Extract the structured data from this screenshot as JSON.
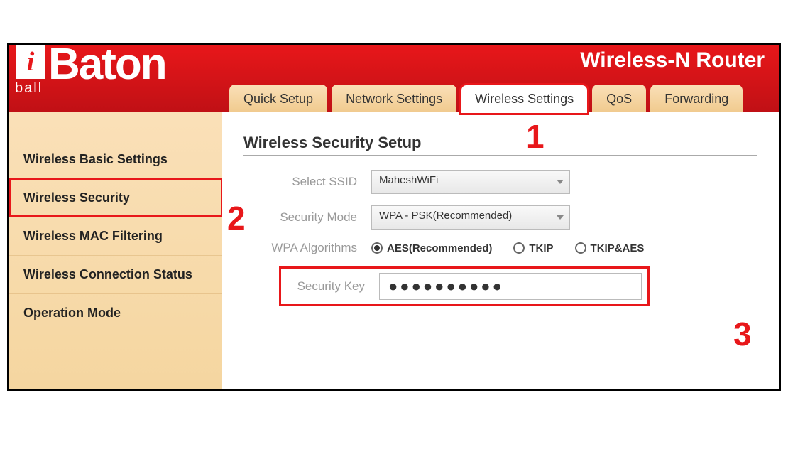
{
  "logo": {
    "i": "i",
    "ball": "ball",
    "baton": "Baton"
  },
  "product_name": "Wireless-N Router",
  "tabs": [
    {
      "label": "Quick Setup",
      "active": false,
      "highlight": false
    },
    {
      "label": "Network Settings",
      "active": false,
      "highlight": false
    },
    {
      "label": "Wireless Settings",
      "active": true,
      "highlight": true
    },
    {
      "label": "QoS",
      "active": false,
      "highlight": false
    },
    {
      "label": "Forwarding",
      "active": false,
      "highlight": false
    }
  ],
  "sidebar": {
    "items": [
      {
        "label": "Wireless Basic Settings",
        "highlight": false
      },
      {
        "label": "Wireless Security",
        "highlight": true
      },
      {
        "label": "Wireless MAC Filtering",
        "highlight": false
      },
      {
        "label": "Wireless Connection Status",
        "highlight": false
      },
      {
        "label": "Operation Mode",
        "highlight": false
      }
    ]
  },
  "main": {
    "section_title": "Wireless Security Setup",
    "ssid_label": "Select SSID",
    "ssid_value": "MaheshWiFi",
    "security_mode_label": "Security Mode",
    "security_mode_value": "WPA - PSK(Recommended)",
    "wpa_algo_label": "WPA Algorithms",
    "wpa_algos": [
      {
        "label": "AES(Recommended)",
        "selected": true
      },
      {
        "label": "TKIP",
        "selected": false
      },
      {
        "label": "TKIP&AES",
        "selected": false
      }
    ],
    "security_key_label": "Security Key",
    "security_key_value": "●●●●●●●●●●"
  },
  "annotations": {
    "one": "1",
    "two": "2",
    "three": "3"
  }
}
